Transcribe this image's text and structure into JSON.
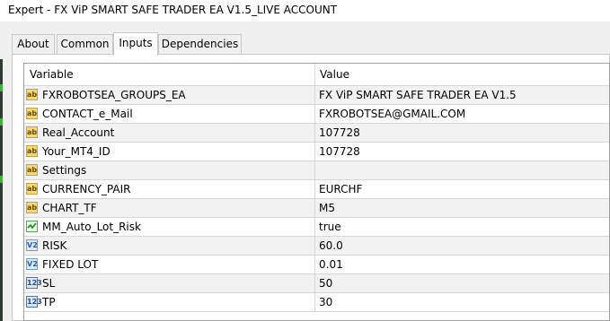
{
  "window": {
    "title": "Expert - FX ViP SMART SAFE TRADER EA V1.5_LIVE ACCOUNT"
  },
  "tabs": [
    {
      "label": "About"
    },
    {
      "label": "Common"
    },
    {
      "label": "Inputs",
      "active": true
    },
    {
      "label": "Dependencies"
    }
  ],
  "table": {
    "headers": {
      "variable": "Variable",
      "value": "Value"
    },
    "rows": [
      {
        "icon": "string-type-icon",
        "type_label": "ab",
        "name": "FXROBOTSEA_GROUPS_EA",
        "value": "FX ViP SMART SAFE TRADER EA V1.5"
      },
      {
        "icon": "string-type-icon",
        "type_label": "ab",
        "name": "CONTACT_e_Mail",
        "value": "FXROBOTSEA@GMAIL.COM"
      },
      {
        "icon": "string-type-icon",
        "type_label": "ab",
        "name": "Real_Account",
        "value": "107728"
      },
      {
        "icon": "string-type-icon",
        "type_label": "ab",
        "name": "Your_MT4_ID",
        "value": "107728"
      },
      {
        "icon": "string-type-icon",
        "type_label": "ab",
        "name": "Settings",
        "value": ""
      },
      {
        "icon": "string-type-icon",
        "type_label": "ab",
        "name": "CURRENCY_PAIR",
        "value": "EURCHF"
      },
      {
        "icon": "string-type-icon",
        "type_label": "ab",
        "name": "CHART_TF",
        "value": "M5"
      },
      {
        "icon": "bool-type-icon",
        "type_label": "",
        "name": "MM_Auto_Lot_Risk",
        "value": "true"
      },
      {
        "icon": "double-type-icon",
        "type_label": "V2",
        "name": "RISK",
        "value": "60.0"
      },
      {
        "icon": "double-type-icon",
        "type_label": "V2",
        "name": "FIXED LOT",
        "value": "0.01"
      },
      {
        "icon": "int-type-icon",
        "type_label": "123",
        "name": "SL",
        "value": "50"
      },
      {
        "icon": "int-type-icon",
        "type_label": "123",
        "name": "TP",
        "value": "30"
      }
    ]
  }
}
